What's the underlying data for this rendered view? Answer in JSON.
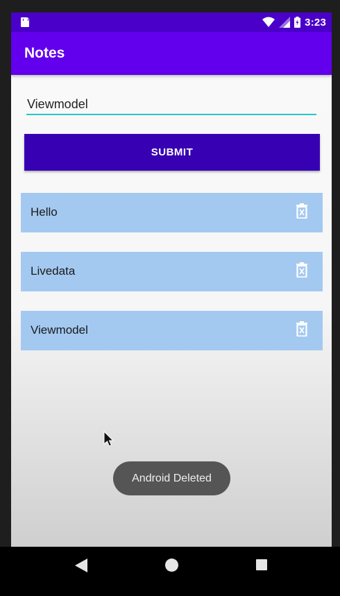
{
  "status_bar": {
    "time": "3:23",
    "icons": [
      "sd-card-icon",
      "wifi-icon",
      "signal-icon",
      "battery-icon"
    ]
  },
  "app_bar": {
    "title": "Notes",
    "color": "#6200ee"
  },
  "input": {
    "value": "Viewmodel",
    "underline_color": "#26c6c6"
  },
  "submit": {
    "label": "SUBMIT",
    "color": "#3700b3"
  },
  "notes": [
    {
      "text": "Hello",
      "icon": "delete-icon"
    },
    {
      "text": "Livedata",
      "icon": "delete-icon"
    },
    {
      "text": "Viewmodel",
      "icon": "delete-icon"
    }
  ],
  "card_color": "#a4c9f1",
  "toast": {
    "message": "Android Deleted"
  },
  "nav_bar": {
    "buttons": [
      "back-icon",
      "home-icon",
      "recents-icon"
    ]
  }
}
